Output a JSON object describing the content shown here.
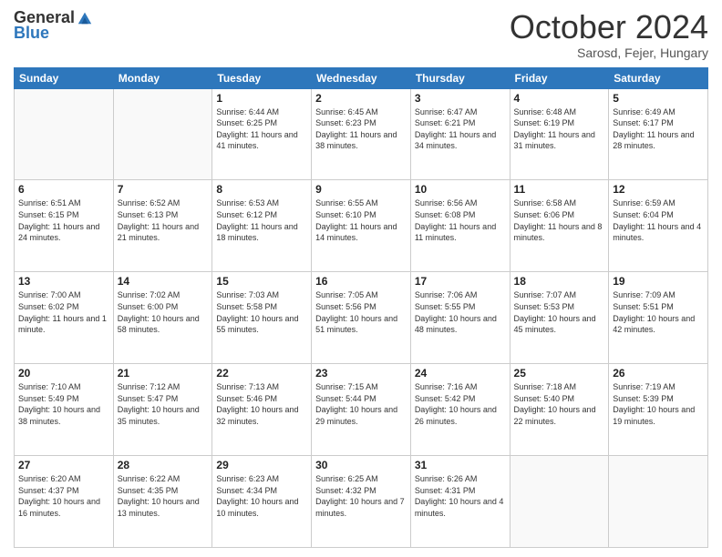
{
  "header": {
    "logo_general": "General",
    "logo_blue": "Blue",
    "month_title": "October 2024",
    "location": "Sarosd, Fejer, Hungary"
  },
  "days_of_week": [
    "Sunday",
    "Monday",
    "Tuesday",
    "Wednesday",
    "Thursday",
    "Friday",
    "Saturday"
  ],
  "weeks": [
    [
      {
        "day": "",
        "sunrise": "",
        "sunset": "",
        "daylight": ""
      },
      {
        "day": "",
        "sunrise": "",
        "sunset": "",
        "daylight": ""
      },
      {
        "day": "1",
        "sunrise": "Sunrise: 6:44 AM",
        "sunset": "Sunset: 6:25 PM",
        "daylight": "Daylight: 11 hours and 41 minutes."
      },
      {
        "day": "2",
        "sunrise": "Sunrise: 6:45 AM",
        "sunset": "Sunset: 6:23 PM",
        "daylight": "Daylight: 11 hours and 38 minutes."
      },
      {
        "day": "3",
        "sunrise": "Sunrise: 6:47 AM",
        "sunset": "Sunset: 6:21 PM",
        "daylight": "Daylight: 11 hours and 34 minutes."
      },
      {
        "day": "4",
        "sunrise": "Sunrise: 6:48 AM",
        "sunset": "Sunset: 6:19 PM",
        "daylight": "Daylight: 11 hours and 31 minutes."
      },
      {
        "day": "5",
        "sunrise": "Sunrise: 6:49 AM",
        "sunset": "Sunset: 6:17 PM",
        "daylight": "Daylight: 11 hours and 28 minutes."
      }
    ],
    [
      {
        "day": "6",
        "sunrise": "Sunrise: 6:51 AM",
        "sunset": "Sunset: 6:15 PM",
        "daylight": "Daylight: 11 hours and 24 minutes."
      },
      {
        "day": "7",
        "sunrise": "Sunrise: 6:52 AM",
        "sunset": "Sunset: 6:13 PM",
        "daylight": "Daylight: 11 hours and 21 minutes."
      },
      {
        "day": "8",
        "sunrise": "Sunrise: 6:53 AM",
        "sunset": "Sunset: 6:12 PM",
        "daylight": "Daylight: 11 hours and 18 minutes."
      },
      {
        "day": "9",
        "sunrise": "Sunrise: 6:55 AM",
        "sunset": "Sunset: 6:10 PM",
        "daylight": "Daylight: 11 hours and 14 minutes."
      },
      {
        "day": "10",
        "sunrise": "Sunrise: 6:56 AM",
        "sunset": "Sunset: 6:08 PM",
        "daylight": "Daylight: 11 hours and 11 minutes."
      },
      {
        "day": "11",
        "sunrise": "Sunrise: 6:58 AM",
        "sunset": "Sunset: 6:06 PM",
        "daylight": "Daylight: 11 hours and 8 minutes."
      },
      {
        "day": "12",
        "sunrise": "Sunrise: 6:59 AM",
        "sunset": "Sunset: 6:04 PM",
        "daylight": "Daylight: 11 hours and 4 minutes."
      }
    ],
    [
      {
        "day": "13",
        "sunrise": "Sunrise: 7:00 AM",
        "sunset": "Sunset: 6:02 PM",
        "daylight": "Daylight: 11 hours and 1 minute."
      },
      {
        "day": "14",
        "sunrise": "Sunrise: 7:02 AM",
        "sunset": "Sunset: 6:00 PM",
        "daylight": "Daylight: 10 hours and 58 minutes."
      },
      {
        "day": "15",
        "sunrise": "Sunrise: 7:03 AM",
        "sunset": "Sunset: 5:58 PM",
        "daylight": "Daylight: 10 hours and 55 minutes."
      },
      {
        "day": "16",
        "sunrise": "Sunrise: 7:05 AM",
        "sunset": "Sunset: 5:56 PM",
        "daylight": "Daylight: 10 hours and 51 minutes."
      },
      {
        "day": "17",
        "sunrise": "Sunrise: 7:06 AM",
        "sunset": "Sunset: 5:55 PM",
        "daylight": "Daylight: 10 hours and 48 minutes."
      },
      {
        "day": "18",
        "sunrise": "Sunrise: 7:07 AM",
        "sunset": "Sunset: 5:53 PM",
        "daylight": "Daylight: 10 hours and 45 minutes."
      },
      {
        "day": "19",
        "sunrise": "Sunrise: 7:09 AM",
        "sunset": "Sunset: 5:51 PM",
        "daylight": "Daylight: 10 hours and 42 minutes."
      }
    ],
    [
      {
        "day": "20",
        "sunrise": "Sunrise: 7:10 AM",
        "sunset": "Sunset: 5:49 PM",
        "daylight": "Daylight: 10 hours and 38 minutes."
      },
      {
        "day": "21",
        "sunrise": "Sunrise: 7:12 AM",
        "sunset": "Sunset: 5:47 PM",
        "daylight": "Daylight: 10 hours and 35 minutes."
      },
      {
        "day": "22",
        "sunrise": "Sunrise: 7:13 AM",
        "sunset": "Sunset: 5:46 PM",
        "daylight": "Daylight: 10 hours and 32 minutes."
      },
      {
        "day": "23",
        "sunrise": "Sunrise: 7:15 AM",
        "sunset": "Sunset: 5:44 PM",
        "daylight": "Daylight: 10 hours and 29 minutes."
      },
      {
        "day": "24",
        "sunrise": "Sunrise: 7:16 AM",
        "sunset": "Sunset: 5:42 PM",
        "daylight": "Daylight: 10 hours and 26 minutes."
      },
      {
        "day": "25",
        "sunrise": "Sunrise: 7:18 AM",
        "sunset": "Sunset: 5:40 PM",
        "daylight": "Daylight: 10 hours and 22 minutes."
      },
      {
        "day": "26",
        "sunrise": "Sunrise: 7:19 AM",
        "sunset": "Sunset: 5:39 PM",
        "daylight": "Daylight: 10 hours and 19 minutes."
      }
    ],
    [
      {
        "day": "27",
        "sunrise": "Sunrise: 6:20 AM",
        "sunset": "Sunset: 4:37 PM",
        "daylight": "Daylight: 10 hours and 16 minutes."
      },
      {
        "day": "28",
        "sunrise": "Sunrise: 6:22 AM",
        "sunset": "Sunset: 4:35 PM",
        "daylight": "Daylight: 10 hours and 13 minutes."
      },
      {
        "day": "29",
        "sunrise": "Sunrise: 6:23 AM",
        "sunset": "Sunset: 4:34 PM",
        "daylight": "Daylight: 10 hours and 10 minutes."
      },
      {
        "day": "30",
        "sunrise": "Sunrise: 6:25 AM",
        "sunset": "Sunset: 4:32 PM",
        "daylight": "Daylight: 10 hours and 7 minutes."
      },
      {
        "day": "31",
        "sunrise": "Sunrise: 6:26 AM",
        "sunset": "Sunset: 4:31 PM",
        "daylight": "Daylight: 10 hours and 4 minutes."
      },
      {
        "day": "",
        "sunrise": "",
        "sunset": "",
        "daylight": ""
      },
      {
        "day": "",
        "sunrise": "",
        "sunset": "",
        "daylight": ""
      }
    ]
  ]
}
